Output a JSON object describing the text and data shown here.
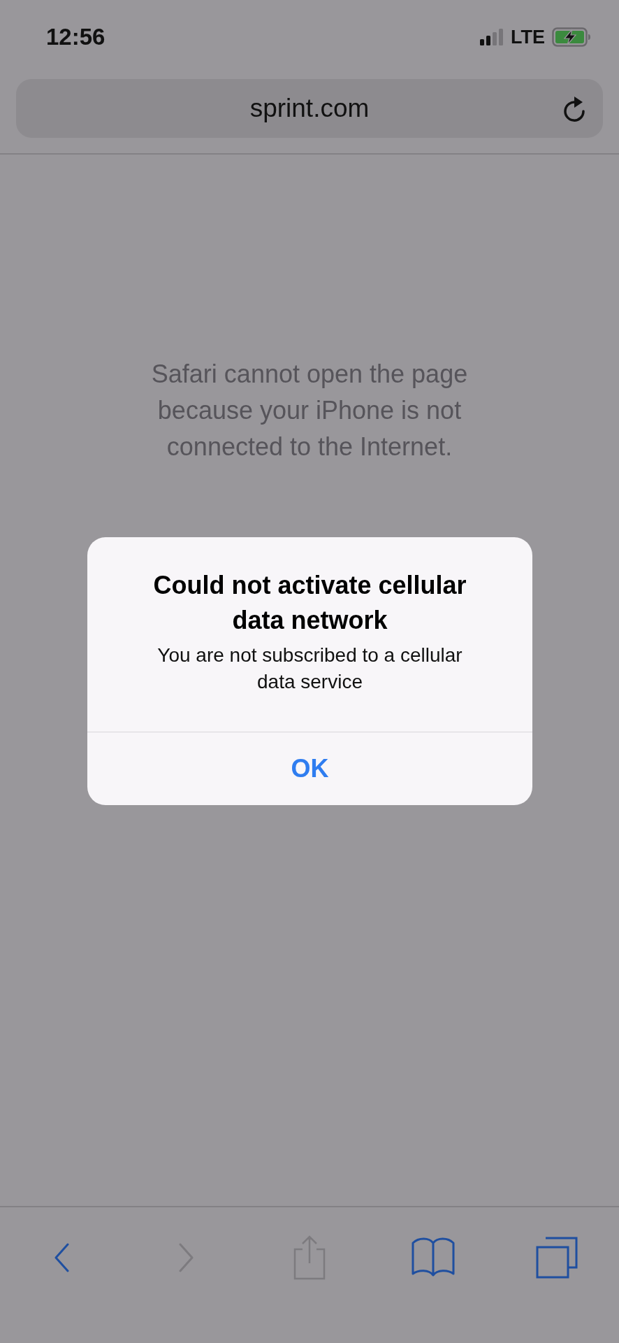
{
  "status_bar": {
    "time": "12:56",
    "network": "LTE"
  },
  "address_bar": {
    "url": "sprint.com"
  },
  "page": {
    "message": "Safari cannot open the page because your iPhone is not connected to the Internet."
  },
  "alert": {
    "title": "Could not activate cellular data network",
    "message": "You are not subscribed to a cellular data service",
    "buttons": [
      "OK"
    ]
  },
  "toolbar": [
    {
      "kind": "back",
      "disabled": false
    },
    {
      "kind": "forward",
      "disabled": true
    },
    {
      "kind": "share",
      "disabled": true
    },
    {
      "kind": "bookmarks",
      "disabled": false
    },
    {
      "kind": "tabs",
      "disabled": false
    }
  ]
}
